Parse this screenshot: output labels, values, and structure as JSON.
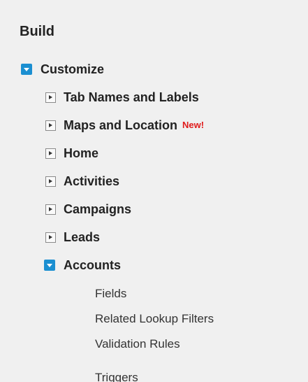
{
  "section": {
    "title": "Build"
  },
  "tree": {
    "customize": {
      "label": "Customize",
      "expanded": true,
      "children": [
        {
          "label": "Tab Names and Labels"
        },
        {
          "label": "Maps and Location",
          "badge": "New!"
        },
        {
          "label": "Home"
        },
        {
          "label": "Activities"
        },
        {
          "label": "Campaigns"
        },
        {
          "label": "Leads"
        },
        {
          "label": "Accounts",
          "expanded": true,
          "children": [
            {
              "label": "Fields"
            },
            {
              "label": "Related Lookup Filters"
            },
            {
              "label": "Validation Rules"
            },
            {
              "label": "Triggers"
            }
          ]
        }
      ]
    }
  },
  "colors": {
    "expander_open": "#1b8fd1",
    "new_badge": "#e01b1b",
    "panel_background": "#f0f0f0"
  },
  "icons": {
    "expanded": "expanded-toggle-icon",
    "collapsed": "collapsed-toggle-icon"
  }
}
